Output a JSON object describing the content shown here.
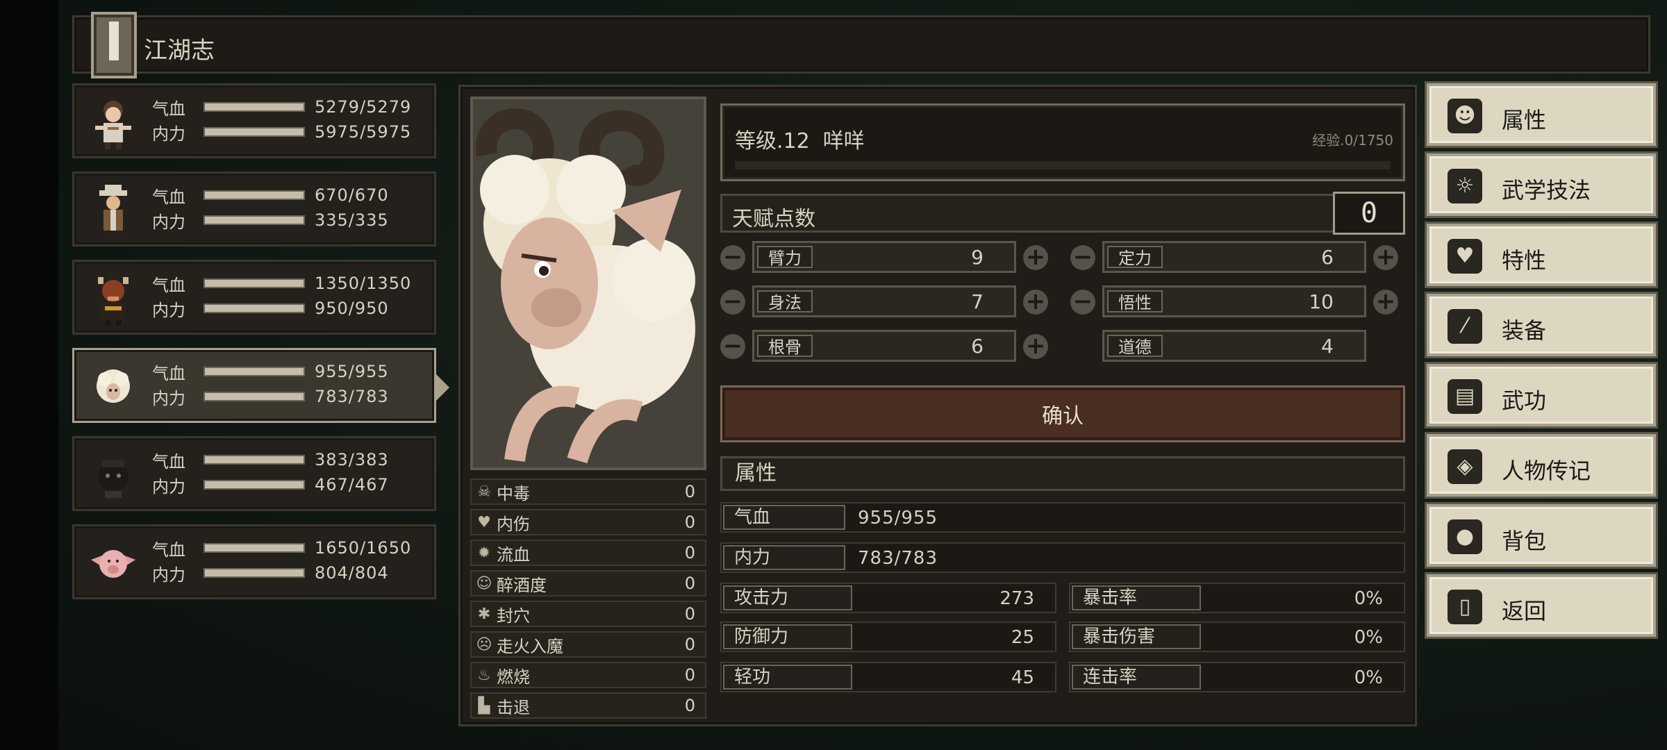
{
  "header": {
    "title": "江湖志",
    "book_icon": "book-icon"
  },
  "party": [
    {
      "avatar": "boy-avatar",
      "hp_label": "气血",
      "hp": "5279/5279",
      "mp_label": "内力",
      "mp": "5975/5975",
      "selected": false
    },
    {
      "avatar": "hat-man-avatar",
      "hp_label": "气血",
      "hp": "670/670",
      "mp_label": "内力",
      "mp": "335/335",
      "selected": false
    },
    {
      "avatar": "bull-avatar",
      "hp_label": "气血",
      "hp": "1350/1350",
      "mp_label": "内力",
      "mp": "950/950",
      "selected": false
    },
    {
      "avatar": "sheep-avatar",
      "hp_label": "气血",
      "hp": "955/955",
      "mp_label": "内力",
      "mp": "783/783",
      "selected": true
    },
    {
      "avatar": "dark-creature-avatar",
      "hp_label": "气血",
      "hp": "383/383",
      "mp_label": "内力",
      "mp": "467/467",
      "selected": false
    },
    {
      "avatar": "pig-avatar",
      "hp_label": "气血",
      "hp": "1650/1650",
      "mp_label": "内力",
      "mp": "804/804",
      "selected": false
    }
  ],
  "character": {
    "level_text": "等级.12",
    "name": "咩咩",
    "exp_text": "经验.0/1750",
    "exp_fraction": 0
  },
  "talent": {
    "label": "天赋点数",
    "points": "0"
  },
  "attributes": [
    {
      "label": "臂力",
      "value": "9"
    },
    {
      "label": "定力",
      "value": "6"
    },
    {
      "label": "身法",
      "value": "7"
    },
    {
      "label": "悟性",
      "value": "10"
    },
    {
      "label": "根骨",
      "value": "6"
    },
    {
      "label": "道德",
      "value": "4"
    }
  ],
  "confirm_label": "确认",
  "status_effects": [
    {
      "icon": "skull-icon",
      "label": "中毒",
      "value": "0"
    },
    {
      "icon": "broken-heart-icon",
      "label": "内伤",
      "value": "0"
    },
    {
      "icon": "blood-icon",
      "label": "流血",
      "value": "0"
    },
    {
      "icon": "dizzy-icon",
      "label": "醉酒度",
      "value": "0"
    },
    {
      "icon": "acupoint-icon",
      "label": "封穴",
      "value": "0"
    },
    {
      "icon": "demon-icon",
      "label": "走火入魔",
      "value": "0"
    },
    {
      "icon": "fire-icon",
      "label": "燃烧",
      "value": "0"
    },
    {
      "icon": "boot-icon",
      "label": "击退",
      "value": "0"
    }
  ],
  "properties": {
    "header": "属性",
    "hp_label": "气血",
    "hp_value": "955/955",
    "mp_label": "内力",
    "mp_value": "783/783",
    "attack_label": "攻击力",
    "attack_value": "273",
    "crit_rate_label": "暴击率",
    "crit_rate_value": "0%",
    "defense_label": "防御力",
    "defense_value": "25",
    "crit_damage_label": "暴击伤害",
    "crit_damage_value": "0%",
    "agility_label": "轻功",
    "agility_value": "45",
    "combo_label": "连击率",
    "combo_value": "0%"
  },
  "menu": [
    {
      "icon": "person-icon",
      "glyph": "☻",
      "label": "属性"
    },
    {
      "icon": "martial-skills-icon",
      "glyph": "☼",
      "label": "武学技法"
    },
    {
      "icon": "trait-icon",
      "glyph": "♥",
      "label": "特性"
    },
    {
      "icon": "sword-icon",
      "glyph": "⁄",
      "label": "装备"
    },
    {
      "icon": "scroll-book-icon",
      "glyph": "▤",
      "label": "武功"
    },
    {
      "icon": "biography-icon",
      "glyph": "◈",
      "label": "人物传记"
    },
    {
      "icon": "bag-icon",
      "glyph": "●",
      "label": "背包"
    },
    {
      "icon": "door-icon",
      "glyph": "▯",
      "label": "返回"
    }
  ],
  "colors": {
    "accent_confirm": "#4b2e22",
    "menu_bg": "#ddd7c2",
    "panel_bg": "#201d18"
  }
}
